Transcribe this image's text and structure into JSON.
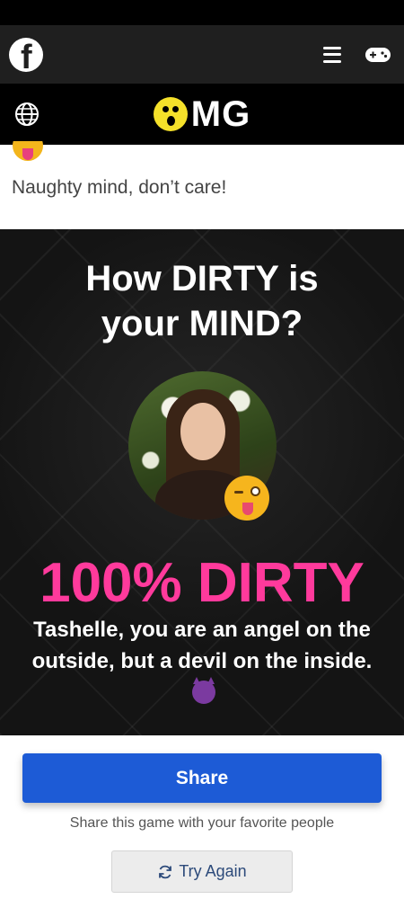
{
  "answer": {
    "text": "Naughty mind, don’t care!"
  },
  "result": {
    "title_line1": "How DIRTY is",
    "title_line2": "your MIND?",
    "score": "100% DIRTY",
    "description": "Tashelle, you are an angel on the outside, but a devil on the inside."
  },
  "actions": {
    "share_label": "Share",
    "share_subtext": "Share this game with your favorite people",
    "try_again_label": "Try Again"
  },
  "header": {
    "logo_text": "MG"
  },
  "colors": {
    "share_button": "#1d5bd6",
    "score_text": "#ff3a9c",
    "logo_face": "#f5e12a"
  },
  "icons": [
    "facebook-icon",
    "menu-icon",
    "gamepad-icon",
    "globe-icon",
    "refresh-icon"
  ]
}
